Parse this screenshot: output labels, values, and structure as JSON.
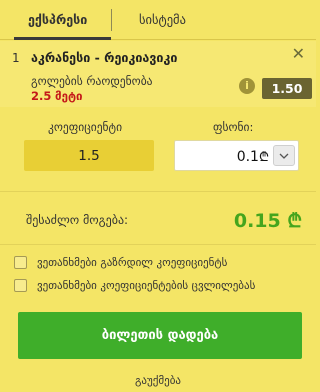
{
  "tabs": {
    "express": "ექსპრესი",
    "system": "სისტემა"
  },
  "bet": {
    "number": "1",
    "title": "აკრანესი - რეიკიავიკი",
    "market": "გოლების რაოდენობა",
    "line_value": "2.5",
    "line_suffix": "მეტი",
    "odds": "1.50",
    "close_glyph": "✕",
    "info_glyph": "i"
  },
  "stake": {
    "coef_label": "კოეფიციენტი",
    "coef_value": "1.5",
    "stake_label": "ფსონი:",
    "stake_value": "0.1",
    "currency": "₾"
  },
  "win": {
    "label": "შესაძლო მოგება:",
    "value": "0.15 ₾"
  },
  "options": [
    "ვეთანხმები გაზრდილ კოეფიციენტს",
    "ვეთანხმები კოეფიციენტების ცვლილებას"
  ],
  "actions": {
    "place_bet": "ბილეთის დადება",
    "clear": "გაუქმება"
  },
  "colors": {
    "background": "#f4e566",
    "accent_green": "#3fae2a",
    "win_green": "#45a51d",
    "line_red": "#c41919",
    "odds_badge": "#6a6431"
  }
}
